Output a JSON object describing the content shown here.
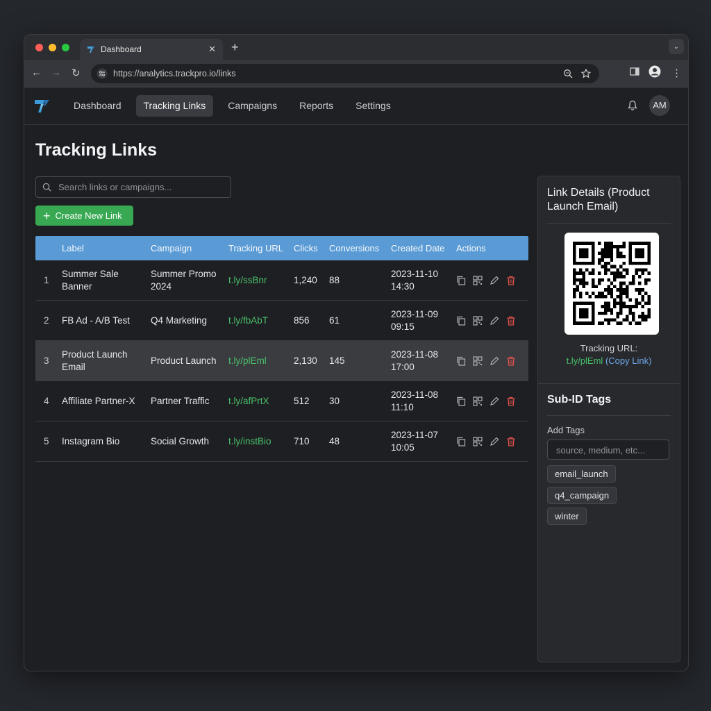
{
  "browser": {
    "tab_title": "Dashboard",
    "url": "https://analytics.trackpro.io/links"
  },
  "nav": {
    "items": [
      {
        "label": "Dashboard",
        "active": false
      },
      {
        "label": "Tracking Links",
        "active": true
      },
      {
        "label": "Campaigns",
        "active": false
      },
      {
        "label": "Reports",
        "active": false
      },
      {
        "label": "Settings",
        "active": false
      }
    ],
    "avatar_initials": "AM"
  },
  "page": {
    "title": "Tracking Links",
    "search_placeholder": "Search links or campaigns...",
    "create_button": "Create New Link"
  },
  "table": {
    "headers": [
      "Label",
      "Campaign",
      "Tracking URL",
      "Clicks",
      "Conversions",
      "Created Date",
      "Actions"
    ],
    "rows": [
      {
        "num": "1",
        "label": "Summer Sale Banner",
        "campaign": "Summer Promo 2024",
        "url": "t.ly/ssBnr",
        "clicks": "1,240",
        "conversions": "88",
        "date": "2023-11-10",
        "time": "14:30"
      },
      {
        "num": "2",
        "label": "FB Ad - A/B Test",
        "campaign": "Q4 Marketing",
        "url": "t.ly/fbAbT",
        "clicks": "856",
        "conversions": "61",
        "date": "2023-11-09",
        "time": "09:15"
      },
      {
        "num": "3",
        "label": "Product Launch Email",
        "campaign": "Product Launch",
        "url": "t.ly/plEml",
        "clicks": "2,130",
        "conversions": "145",
        "date": "2023-11-08",
        "time": "17:00"
      },
      {
        "num": "4",
        "label": "Affiliate Partner-X",
        "campaign": "Partner Traffic",
        "url": "t.ly/afPrtX",
        "clicks": "512",
        "conversions": "30",
        "date": "2023-11-08",
        "time": "11:10"
      },
      {
        "num": "5",
        "label": "Instagram Bio",
        "campaign": "Social Growth",
        "url": "t.ly/instBio",
        "clicks": "710",
        "conversions": "48",
        "date": "2023-11-07",
        "time": "10:05"
      }
    ],
    "selected_row": 3
  },
  "details": {
    "title": "Link Details (Product Launch Email)",
    "tracking_label": "Tracking URL:",
    "tracking_url": "t.ly/plEml",
    "copy_link": "(Copy Link)"
  },
  "subid": {
    "title": "Sub-ID Tags",
    "add_label": "Add Tags",
    "input_placeholder": "source, medium, etc...",
    "tags": [
      "email_launch",
      "q4_campaign",
      "winter"
    ]
  },
  "colors": {
    "accent_blue": "#5b9bd5",
    "create_green": "#38a852",
    "url_green": "#49c06a",
    "delete_red": "#e0524c"
  }
}
